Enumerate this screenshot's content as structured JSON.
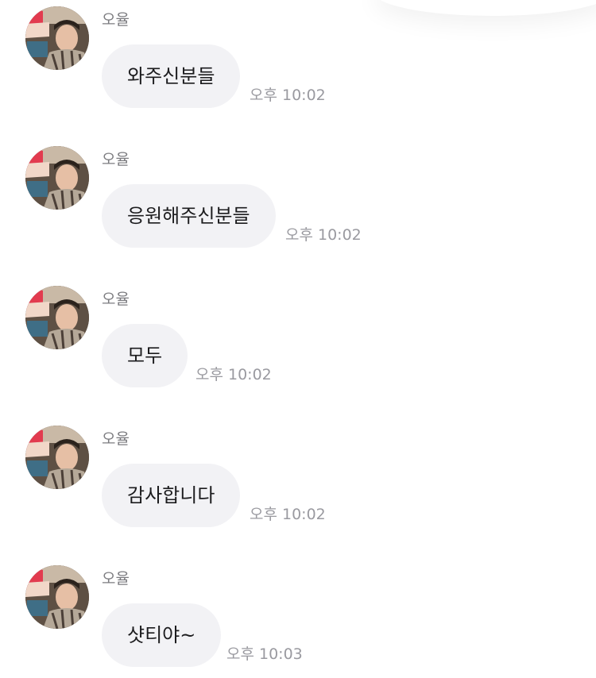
{
  "messages": [
    {
      "sender": "오율",
      "text": "와주신분들",
      "time": "오후 10:02"
    },
    {
      "sender": "오율",
      "text": "응원해주신분들",
      "time": "오후 10:02"
    },
    {
      "sender": "오율",
      "text": "모두",
      "time": "오후 10:02"
    },
    {
      "sender": "오율",
      "text": "감사합니다",
      "time": "오후 10:02"
    },
    {
      "sender": "오율",
      "text": "샷티야~",
      "time": "오후 10:03"
    }
  ]
}
